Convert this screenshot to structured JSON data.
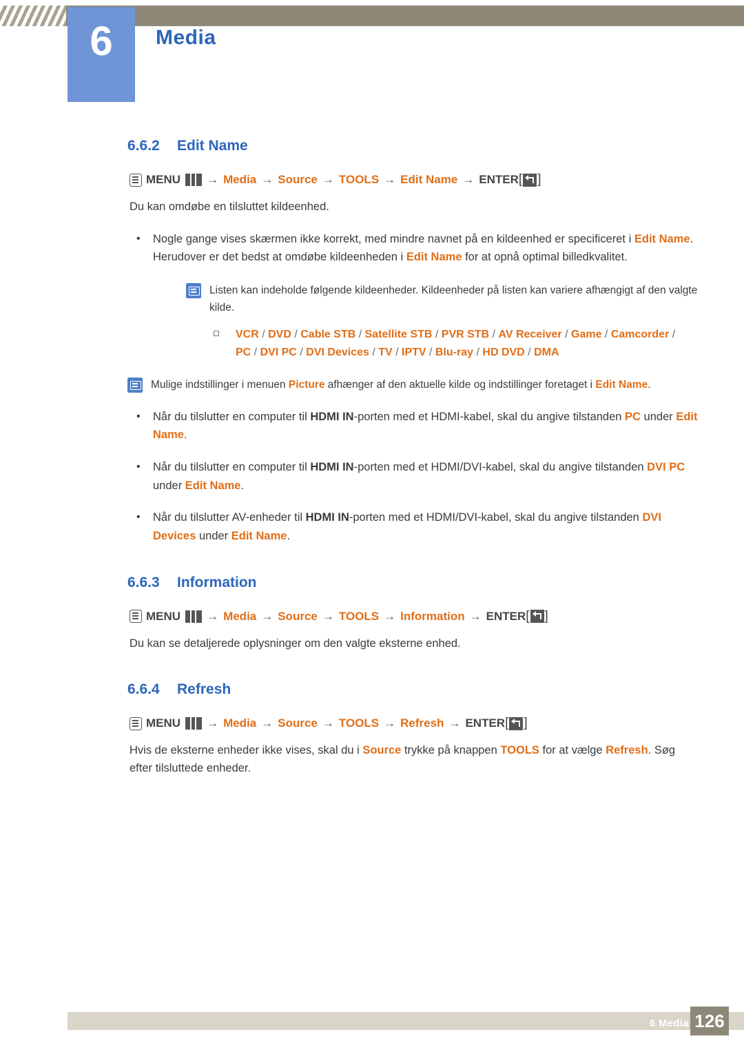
{
  "header": {
    "chapter_number": "6",
    "chapter_title": "Media"
  },
  "sections": [
    {
      "number": "6.6.2",
      "title": "Edit Name",
      "path": {
        "menu": "MENU",
        "items": [
          "Media",
          "Source",
          "TOOLS",
          "Edit Name"
        ],
        "enter": "ENTER",
        "bracket_open": "[",
        "bracket_close": "]"
      },
      "intro": "Du kan omdøbe en tilsluttet kildeenhed."
    },
    {
      "number": "6.6.3",
      "title": "Information",
      "path": {
        "menu": "MENU",
        "items": [
          "Media",
          "Source",
          "TOOLS",
          "Information"
        ],
        "enter": "ENTER",
        "bracket_open": "[",
        "bracket_close": "]"
      },
      "intro": "Du kan se detaljerede oplysninger om den valgte eksterne enhed."
    },
    {
      "number": "6.6.4",
      "title": "Refresh",
      "path": {
        "menu": "MENU",
        "items": [
          "Media",
          "Source",
          "TOOLS",
          "Refresh"
        ],
        "enter": "ENTER",
        "bracket_open": "[",
        "bracket_close": "]"
      }
    }
  ],
  "bullets": {
    "b1": {
      "p1": "Nogle gange vises skærmen ikke korrekt, med mindre navnet på en kildeenhed er specificeret i ",
      "k1": "Edit Name",
      "p2": ". Herudover er det bedst at omdøbe kildeenheden i ",
      "k2": "Edit Name",
      "p3": " for at opnå optimal billedkvalitet.",
      "marker": "•"
    },
    "b2": {
      "p1": "Når du tilslutter en computer til ",
      "k1": "HDMI IN",
      "p2": "-porten med et HDMI-kabel, skal du angive tilstanden ",
      "k2": "PC",
      "p3": " under ",
      "k3": "Edit Name",
      "p4": ".",
      "marker": "•"
    },
    "b3": {
      "p1": "Når du tilslutter en computer til ",
      "k1": "HDMI IN",
      "p2": "-porten med et HDMI/DVI-kabel, skal du angive tilstanden ",
      "k2": "DVI PC",
      "p3": " under ",
      "k3": "Edit Name",
      "p4": ".",
      "marker": "•"
    },
    "b4": {
      "p1": "Når du tilslutter AV-enheder til ",
      "k1": "HDMI IN",
      "p2": "-porten med et HDMI/DVI-kabel, skal du angive tilstanden ",
      "k2": "DVI Devices",
      "p3": " under ",
      "k3": "Edit Name",
      "p4": ".",
      "marker": "•"
    }
  },
  "notes": {
    "note1": {
      "text": "Listen kan indeholde følgende kildeenheder. Kildeenheder på listen kan variere afhængigt af den valgte kilde.",
      "icon": "note-icon"
    },
    "note2": {
      "p1": "Mulige indstillinger i menuen ",
      "k1": "Picture",
      "p2": " afhænger af den aktuelle kilde og indstillinger foretaget i ",
      "k2": "Edit Name",
      "p3": ".",
      "icon": "note-icon"
    }
  },
  "device_list": {
    "line1": [
      "VCR",
      "DVD",
      "Cable STB",
      "Satellite STB",
      "PVR STB",
      "AV Receiver",
      "Game",
      "Camcorder"
    ],
    "line2": [
      "PC",
      "DVI PC",
      "DVI Devices",
      "TV",
      "IPTV",
      "Blu-ray",
      "HD DVD",
      "DMA"
    ],
    "separator": "/"
  },
  "refresh_para": {
    "p1": "Hvis de eksterne enheder ikke vises, skal du i ",
    "k1": "Source",
    "p2": " trykke på knappen ",
    "k2": "TOOLS",
    "p3": " for at vælge ",
    "k3": "Refresh",
    "p4": ". Søg efter tilsluttede enheder."
  },
  "footer": {
    "label": "6 Media",
    "page": "126"
  },
  "colors": {
    "accent_blue": "#2c66bb",
    "badge_blue": "#6f95d6",
    "orange": "#e06e17",
    "header_bar": "#8d8878",
    "footer_bar": "#d9d5c9"
  }
}
